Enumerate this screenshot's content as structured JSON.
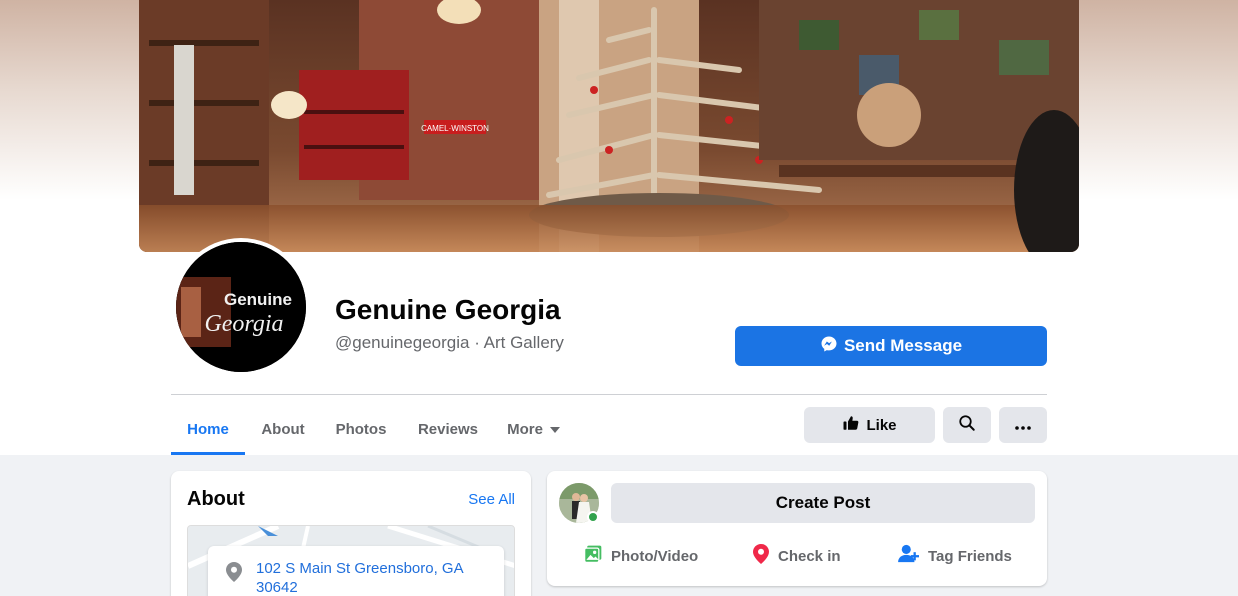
{
  "page": {
    "name": "Genuine Georgia",
    "subtitle": "@genuinegeorgia · Art Gallery",
    "avatar_text_line1": "Genuine",
    "avatar_text_line2": "Georgia",
    "cover_sign_text": "CAMEL·WINSTON"
  },
  "actions": {
    "send_message": "Send Message",
    "like": "Like"
  },
  "tabs": [
    {
      "label": "Home",
      "active": true
    },
    {
      "label": "About",
      "active": false
    },
    {
      "label": "Photos",
      "active": false
    },
    {
      "label": "Reviews",
      "active": false
    },
    {
      "label": "More",
      "active": false
    }
  ],
  "about": {
    "title": "About",
    "see_all": "See All",
    "address": "102 S Main St Greensboro, GA 30642"
  },
  "composer": {
    "create_post": "Create Post",
    "photo_video": "Photo/Video",
    "check_in": "Check in",
    "tag_friends": "Tag Friends"
  },
  "colors": {
    "accent": "#1877f2",
    "button_blue": "#1b74e4",
    "online": "#31a24c",
    "photo_green": "#45bd62",
    "checkin_red": "#f02849"
  },
  "icons": [
    "messenger-icon",
    "thumbs-up-icon",
    "search-icon",
    "more-dots-icon",
    "caret-down-icon",
    "location-pin-icon",
    "photo-icon",
    "check-in-icon",
    "tag-friends-icon"
  ]
}
